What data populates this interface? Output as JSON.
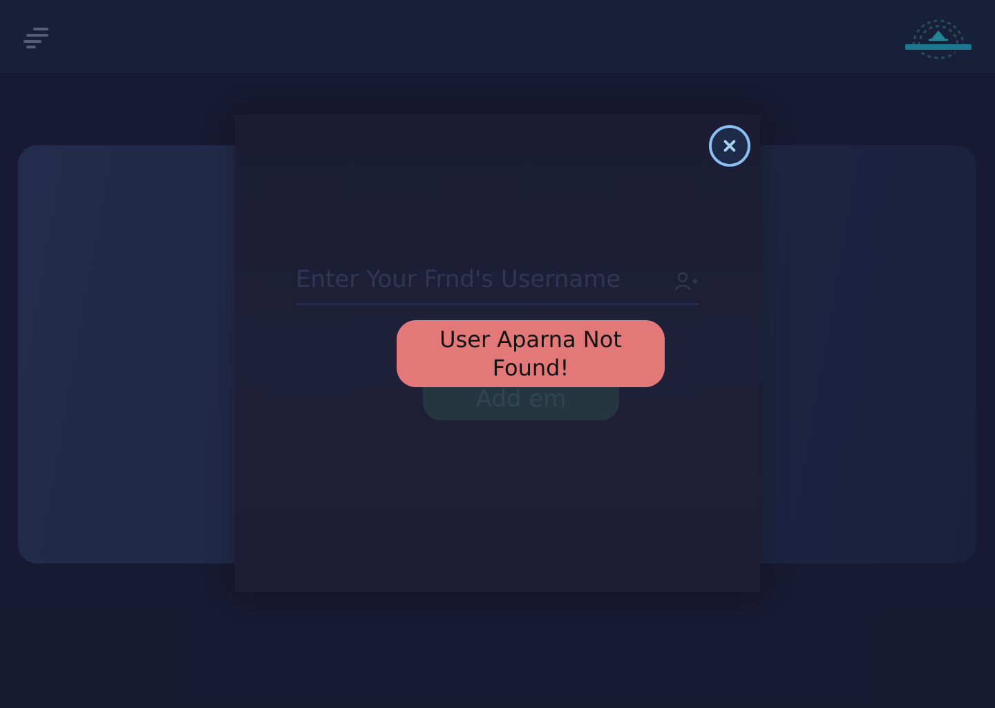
{
  "header": {
    "menu_icon": "menu-icon",
    "logo_icon": "brand-logo-icon"
  },
  "modal": {
    "close_icon": "close-icon",
    "username_placeholder": "Enter Your Frnd's Username",
    "add_user_icon": "add-user-icon",
    "add_button_label": "Add em"
  },
  "toast": {
    "message": "User Aparna Not Found!"
  },
  "colors": {
    "background": "#1b1d38",
    "topbar": "#1a2441",
    "toast": "#e27878",
    "close_ring": "#8cc0f2",
    "logo_accent": "#2aa6b8"
  }
}
